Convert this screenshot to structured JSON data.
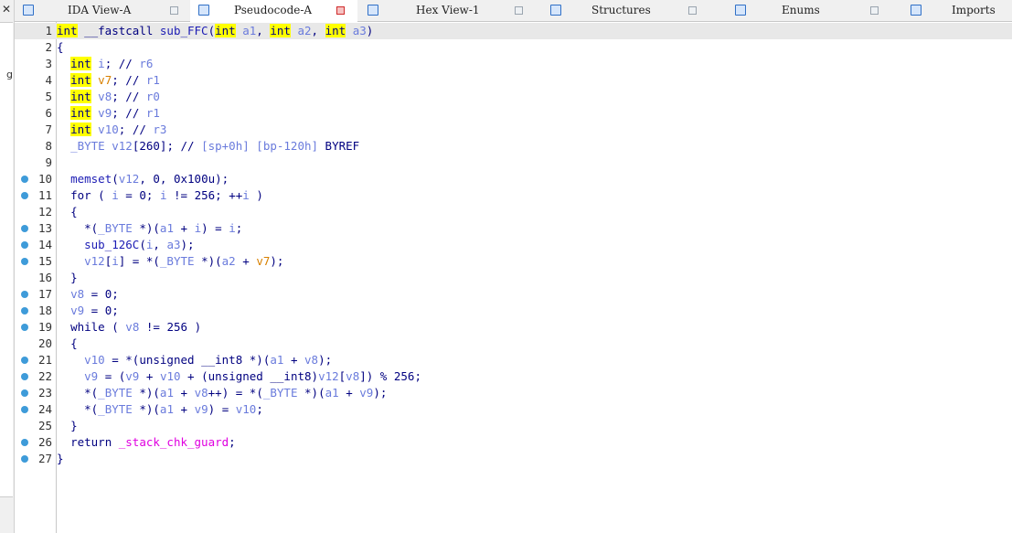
{
  "tabs": [
    {
      "label": "IDA View-A",
      "active": false,
      "close_color": "gray"
    },
    {
      "label": "Pseudocode-A",
      "active": true,
      "close_color": "red"
    },
    {
      "label": "Hex View-1",
      "active": false,
      "close_color": "gray"
    },
    {
      "label": "Structures",
      "active": false,
      "close_color": "gray"
    },
    {
      "label": "Enums",
      "active": false,
      "close_color": "gray"
    },
    {
      "label": "Imports",
      "active": false,
      "close_color": "gray"
    }
  ],
  "side_panel": {
    "close_glyph": "✕",
    "letter": "g"
  },
  "code_lines": [
    {
      "n": "1",
      "bp": false,
      "t": "int __fastcall sub_FFC(int a1, int a2, int a3)"
    },
    {
      "n": "2",
      "bp": false,
      "t": "{"
    },
    {
      "n": "3",
      "bp": false,
      "t": "  int i; // r6"
    },
    {
      "n": "4",
      "bp": false,
      "t": "  int v7; // r1"
    },
    {
      "n": "5",
      "bp": false,
      "t": "  int v8; // r0"
    },
    {
      "n": "6",
      "bp": false,
      "t": "  int v9; // r1"
    },
    {
      "n": "7",
      "bp": false,
      "t": "  int v10; // r3"
    },
    {
      "n": "8",
      "bp": false,
      "t": "  _BYTE v12[260]; // [sp+0h] [bp-120h] BYREF"
    },
    {
      "n": "9",
      "bp": false,
      "t": ""
    },
    {
      "n": "10",
      "bp": true,
      "t": "  memset(v12, 0, 0x100u);"
    },
    {
      "n": "11",
      "bp": true,
      "t": "  for ( i = 0; i != 256; ++i )"
    },
    {
      "n": "12",
      "bp": false,
      "t": "  {"
    },
    {
      "n": "13",
      "bp": true,
      "t": "    *(_BYTE *)(a1 + i) = i;"
    },
    {
      "n": "14",
      "bp": true,
      "t": "    sub_126C(i, a3);"
    },
    {
      "n": "15",
      "bp": true,
      "t": "    v12[i] = *(_BYTE *)(a2 + v7);"
    },
    {
      "n": "16",
      "bp": false,
      "t": "  }"
    },
    {
      "n": "17",
      "bp": true,
      "t": "  v8 = 0;"
    },
    {
      "n": "18",
      "bp": true,
      "t": "  v9 = 0;"
    },
    {
      "n": "19",
      "bp": true,
      "t": "  while ( v8 != 256 )"
    },
    {
      "n": "20",
      "bp": false,
      "t": "  {"
    },
    {
      "n": "21",
      "bp": true,
      "t": "    v10 = *(unsigned __int8 *)(a1 + v8);"
    },
    {
      "n": "22",
      "bp": true,
      "t": "    v9 = (v9 + v10 + (unsigned __int8)v12[v8]) % 256;"
    },
    {
      "n": "23",
      "bp": true,
      "t": "    *(_BYTE *)(a1 + v8++) = *(_BYTE *)(a1 + v9);"
    },
    {
      "n": "24",
      "bp": true,
      "t": "    *(_BYTE *)(a1 + v9) = v10;"
    },
    {
      "n": "25",
      "bp": false,
      "t": "  }"
    },
    {
      "n": "26",
      "bp": true,
      "t": "  return _stack_chk_guard;"
    },
    {
      "n": "27",
      "bp": true,
      "t": "}"
    }
  ],
  "colors": {
    "breakpoint": "#3e9bd9",
    "keyword": "#000080",
    "highlight": "#ffff00",
    "variable": "#6a7bdc",
    "global": "#e000e0",
    "uninit": "#d88000"
  }
}
